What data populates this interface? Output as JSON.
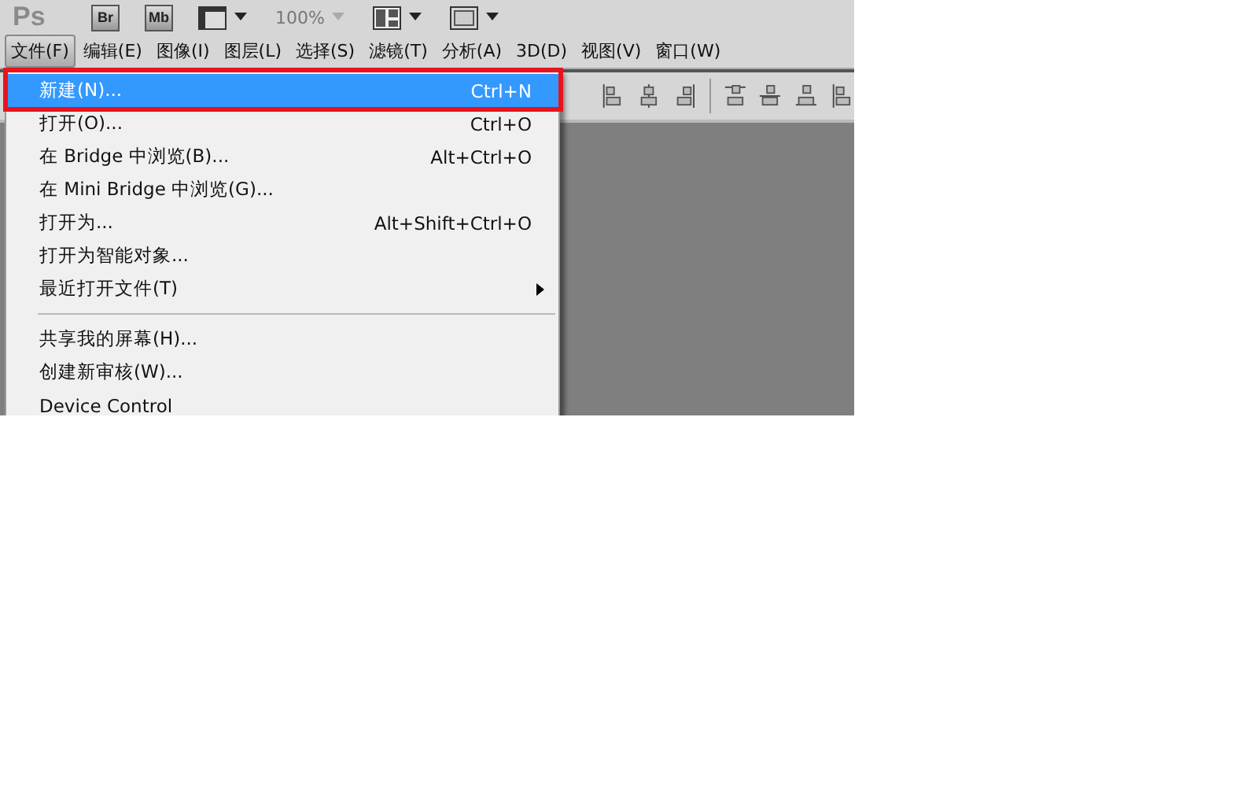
{
  "app_bar": {
    "logo": "Ps",
    "bridge_button": "Br",
    "minibridge_button": "Mb",
    "zoom": "100%"
  },
  "menubar": [
    {
      "label": "文件(F)",
      "selected": true
    },
    {
      "label": "编辑(E)",
      "selected": false
    },
    {
      "label": "图像(I)",
      "selected": false
    },
    {
      "label": "图层(L)",
      "selected": false
    },
    {
      "label": "选择(S)",
      "selected": false
    },
    {
      "label": "滤镜(T)",
      "selected": false
    },
    {
      "label": "分析(A)",
      "selected": false
    },
    {
      "label": "3D(D)",
      "selected": false
    },
    {
      "label": "视图(V)",
      "selected": false
    },
    {
      "label": "窗口(W)",
      "selected": false
    }
  ],
  "file_menu": [
    {
      "kind": "item",
      "label": "新建(N)...",
      "shortcut": "Ctrl+N",
      "selected": true,
      "annotated": true,
      "submenu": false
    },
    {
      "kind": "item",
      "label": "打开(O)...",
      "shortcut": "Ctrl+O",
      "selected": false,
      "annotated": false,
      "submenu": false
    },
    {
      "kind": "item",
      "label": "在 Bridge 中浏览(B)...",
      "shortcut": "Alt+Ctrl+O",
      "selected": false,
      "annotated": false,
      "submenu": false
    },
    {
      "kind": "item",
      "label": "在 Mini Bridge 中浏览(G)...",
      "selected": false,
      "annotated": false,
      "submenu": false
    },
    {
      "kind": "item",
      "label": "打开为...",
      "shortcut": "Alt+Shift+Ctrl+O",
      "selected": false,
      "annotated": false,
      "submenu": false
    },
    {
      "kind": "item",
      "label": "打开为智能对象...",
      "selected": false,
      "annotated": false,
      "submenu": false
    },
    {
      "kind": "item",
      "label": "最近打开文件(T)",
      "selected": false,
      "annotated": false,
      "submenu": true
    },
    {
      "kind": "separator"
    },
    {
      "kind": "item",
      "label": "共享我的屏幕(H)...",
      "selected": false,
      "annotated": false,
      "submenu": false
    },
    {
      "kind": "item",
      "label": "创建新审核(W)...",
      "selected": false,
      "annotated": false,
      "submenu": false
    },
    {
      "kind": "item",
      "label": "Device Control",
      "selected": false,
      "annotated": false,
      "submenu": false
    }
  ]
}
